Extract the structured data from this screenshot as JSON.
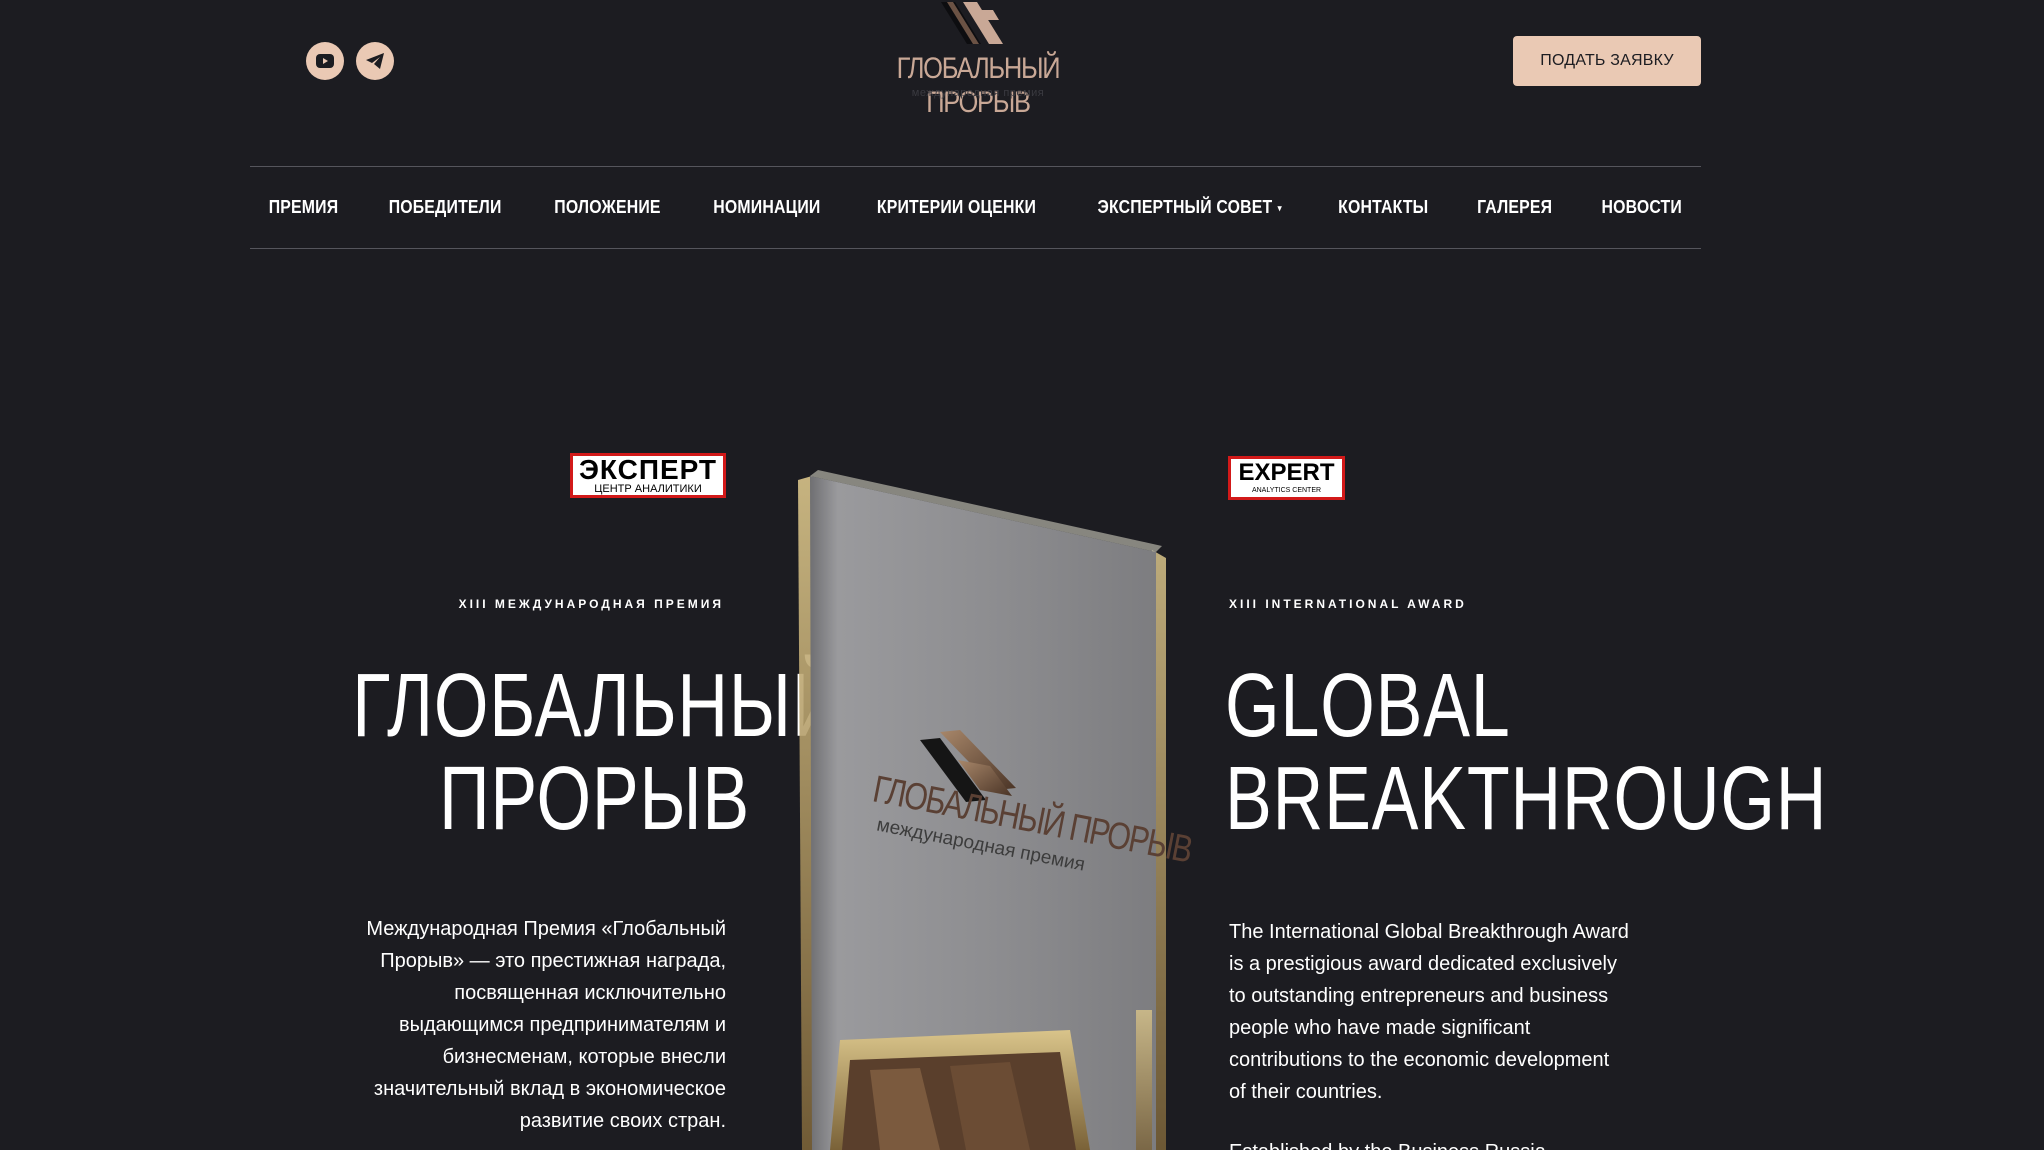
{
  "header": {
    "socials": [
      {
        "icon": "youtube-icon"
      },
      {
        "icon": "telegram-icon"
      }
    ],
    "logo": {
      "title": "ГЛОБАЛЬНЫЙ ПРОРЫВ",
      "subtitle": "международная премия"
    },
    "cta_label": "ПОДАТЬ ЗАЯВКУ"
  },
  "nav": {
    "items": [
      {
        "label": "ПРЕМИЯ"
      },
      {
        "label": "ПОБЕДИТЕЛИ"
      },
      {
        "label": "ПОЛОЖЕНИЕ"
      },
      {
        "label": "НОМИНАЦИИ"
      },
      {
        "label": "КРИТЕРИИ ОЦЕНКИ"
      },
      {
        "label": "ЭКСПЕРТНЫЙ СОВЕТ",
        "caret": "▾"
      },
      {
        "label": "КОНТАКТЫ"
      },
      {
        "label": "ГАЛЕРЕЯ"
      },
      {
        "label": "НОВОСТИ"
      }
    ]
  },
  "hero": {
    "ru": {
      "badge_main": "ЭКСПЕРТ",
      "badge_sub": "ЦЕНТР АНАЛИТИКИ",
      "kicker": "XIII МЕЖДУНАРОДНАЯ ПРЕМИЯ",
      "title_line1": "ГЛОБАЛЬНЫЙ",
      "title_line2": "ПРОРЫВ",
      "description": "Международная Премия «Глобальный Прорыв» — это престижная награда, посвященная исключительно выдающимся предпринимателям и бизнесменам, которые внесли значительный вклад в экономическое развитие своих стран."
    },
    "en": {
      "badge_main": "EXPERT",
      "badge_sub": "ANALYTICS CENTER",
      "kicker": "XIII INTERNATIONAL AWARD",
      "title_line1": "GLOBAL",
      "title_line2": "BREAKTHROUGH",
      "description": "The International Global Breakthrough Award is a prestigious award dedicated exclusively to outstanding entrepreneurs and business people who have made significant contributions to the economic development of their countries.",
      "description_2": "Established by the Business Russia"
    },
    "trophy": {
      "name": "ГЛОБАЛЬНЫЙ ПРОРЫВ",
      "subtitle": "международная премия"
    }
  },
  "colors": {
    "background": "#1c1c21",
    "accent": "#eac9b4",
    "badge_red": "#d21919",
    "text": "#ffffff"
  }
}
